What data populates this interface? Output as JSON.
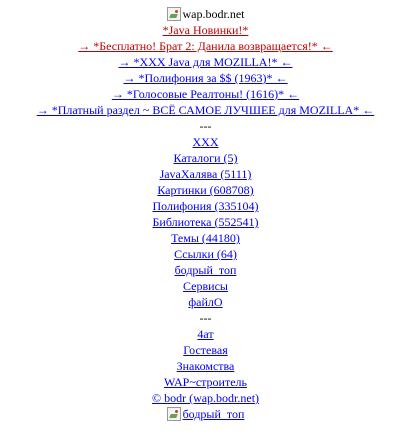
{
  "header": {
    "logo_alt": "wap.bodr.net",
    "java_new": "*Java Новинки!*"
  },
  "promos": [
    "→ *Бесплатно! Брат 2: Данила возвращается!* ←",
    "→ *XXX Java для MOZILLA!* ←",
    "→ *Полифония за $$ (1963)* ←",
    "→ *Голосовые Реалтоны! (1616)* ←",
    "→ *Платный раздел ~ ВСЁ САМОЕ ЛУЧШЕЕ для MOZILLA* ←"
  ],
  "separator": "---",
  "menu": [
    "XXX",
    "Каталоги (5)",
    "JavaХалява (5111)",
    "Картинки (608708)",
    "Полифония (335104)",
    "Библиотека (552541)",
    "Темы (44180)",
    "Ссылки (64)",
    "бодрый_топ",
    "Сервисы",
    "файлО"
  ],
  "footer_menu": [
    "4ат",
    "Гостевая",
    "Знакомства",
    "WAP~строитель",
    "© bodr (wap.bodr.net)"
  ],
  "bottom_banner_alt": "бодрый_топ",
  "colors": {
    "link": "#0000ee",
    "highlight": "#c00000"
  }
}
